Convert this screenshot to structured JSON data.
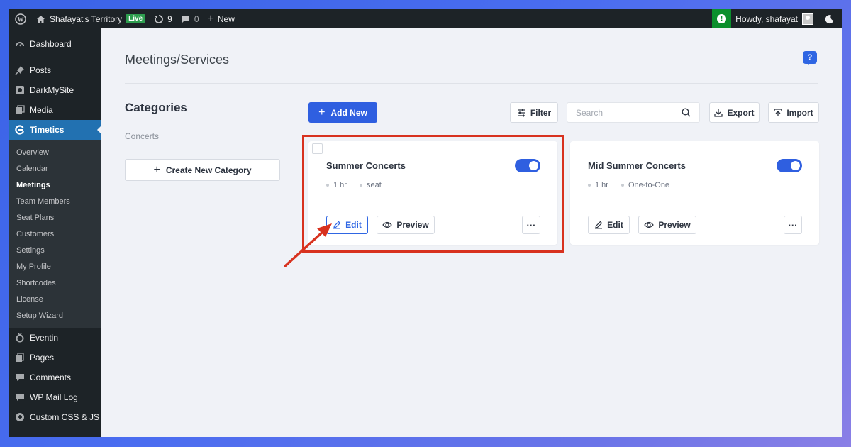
{
  "adminbar": {
    "site_name": "Shafayat's Territory",
    "live_badge": "Live",
    "updates_count": "9",
    "comments_count": "0",
    "new_label": "New",
    "howdy": "Howdy, shafayat"
  },
  "sidebar": {
    "top_items": [
      {
        "label": "Dashboard",
        "icon": "dashboard-icon"
      },
      {
        "label": "Posts",
        "icon": "pin-icon"
      },
      {
        "label": "DarkMySite",
        "icon": "darkmysite-icon"
      },
      {
        "label": "Media",
        "icon": "media-icon"
      },
      {
        "label": "Timetics",
        "icon": "timetics-icon"
      }
    ],
    "submenu": [
      "Overview",
      "Calendar",
      "Meetings",
      "Team Members",
      "Seat Plans",
      "Customers",
      "Settings",
      "My Profile",
      "Shortcodes",
      "License",
      "Setup Wizard"
    ],
    "bottom_items": [
      {
        "label": "Eventin",
        "icon": "eventin-icon"
      },
      {
        "label": "Pages",
        "icon": "pages-icon"
      },
      {
        "label": "Comments",
        "icon": "comments-icon"
      },
      {
        "label": "WP Mail Log",
        "icon": "mail-log-icon"
      },
      {
        "label": "Custom CSS & JS",
        "icon": "plus-circle-icon"
      }
    ]
  },
  "main": {
    "title": "Meetings/Services",
    "help": "?",
    "categories": {
      "title": "Categories",
      "items": [
        "Concerts"
      ],
      "create_label": "Create New Category"
    },
    "toolbar": {
      "add_new": "Add New",
      "filter": "Filter",
      "search_placeholder": "Search",
      "export": "Export",
      "import": "Import"
    },
    "cards": [
      {
        "title": "Summer Concerts",
        "duration": "1 hr",
        "type": "seat",
        "edit": "Edit",
        "preview": "Preview",
        "more": "···",
        "enabled": true
      },
      {
        "title": "Mid Summer Concerts",
        "duration": "1 hr",
        "type": "One-to-One",
        "edit": "Edit",
        "preview": "Preview",
        "more": "···",
        "enabled": true
      }
    ]
  },
  "colors": {
    "accent": "#2f5fe0",
    "highlight": "#d8321f",
    "admin_bar": "#1d2327"
  }
}
